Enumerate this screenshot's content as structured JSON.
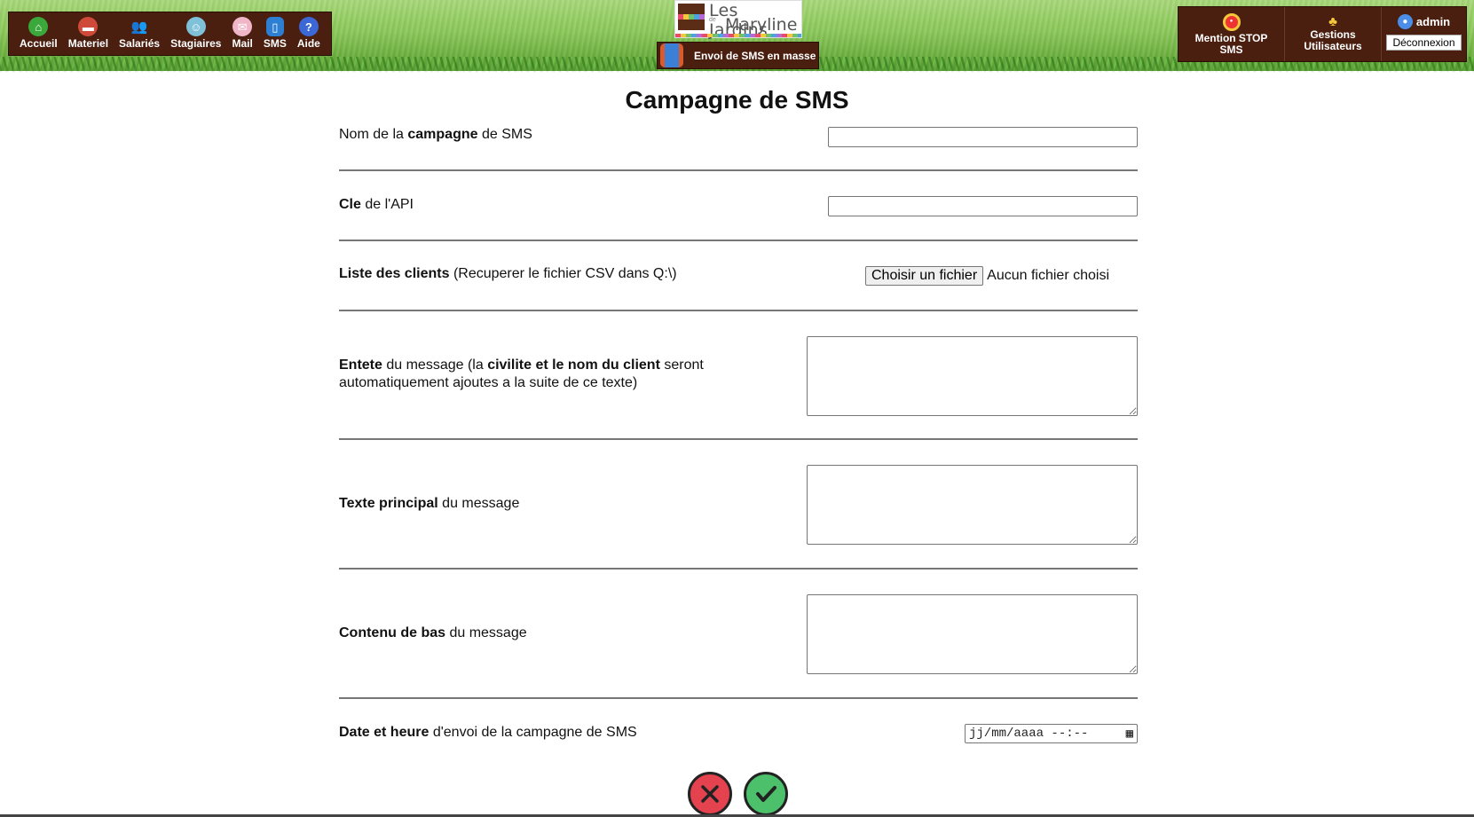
{
  "header": {
    "nav_left": [
      {
        "label": "Accueil",
        "icon": "home-icon"
      },
      {
        "label": "Materiel",
        "icon": "truck-icon"
      },
      {
        "label": "Salariés",
        "icon": "users-icon"
      },
      {
        "label": "Stagiaires",
        "icon": "intern-icon"
      },
      {
        "label": "Mail",
        "icon": "mail-icon"
      },
      {
        "label": "SMS",
        "icon": "phone-icon"
      },
      {
        "label": "Aide",
        "icon": "help-icon"
      }
    ],
    "logo": {
      "line1": "Les Jardins",
      "small": "de",
      "line2": "Maryline"
    },
    "sms_mass_label": "Envoi de SMS en masse",
    "nav_right": {
      "stop_label_1": "Mention STOP",
      "stop_label_2": "SMS",
      "users_label_1": "Gestions",
      "users_label_2": "Utilisateurs",
      "username": "admin",
      "logout_label": "Déconnexion"
    }
  },
  "form": {
    "title": "Campagne de SMS",
    "campaign_name": {
      "bold": "campagne",
      "pre": "Nom de la ",
      "post": " de SMS",
      "value": ""
    },
    "api_key": {
      "bold": "Cle",
      "post": " de l'API",
      "value": ""
    },
    "client_list": {
      "bold": "Liste des clients",
      "post": " (Recuperer le fichier CSV dans Q:\\)",
      "button_label": "Choisir un fichier",
      "status": "Aucun fichier choisi"
    },
    "header_msg": {
      "bold1": "Entete",
      "mid1": " du message (la ",
      "bold2": "civilite et le nom du client",
      "post": " seront automatiquement ajoutes a la suite de ce texte)"
    },
    "main_text": {
      "bold": "Texte principal",
      "post": " du message"
    },
    "footer_msg": {
      "bold": "Contenu de bas",
      "post": " du message"
    },
    "send_datetime": {
      "bold": "Date et heure",
      "post": " d'envoi de la campagne de SMS",
      "placeholder": "jj/mm/aaaa --:--"
    }
  },
  "colors": {
    "brown": "#4a1f0f",
    "cancel": "#e3424e",
    "confirm": "#4cc06a"
  }
}
